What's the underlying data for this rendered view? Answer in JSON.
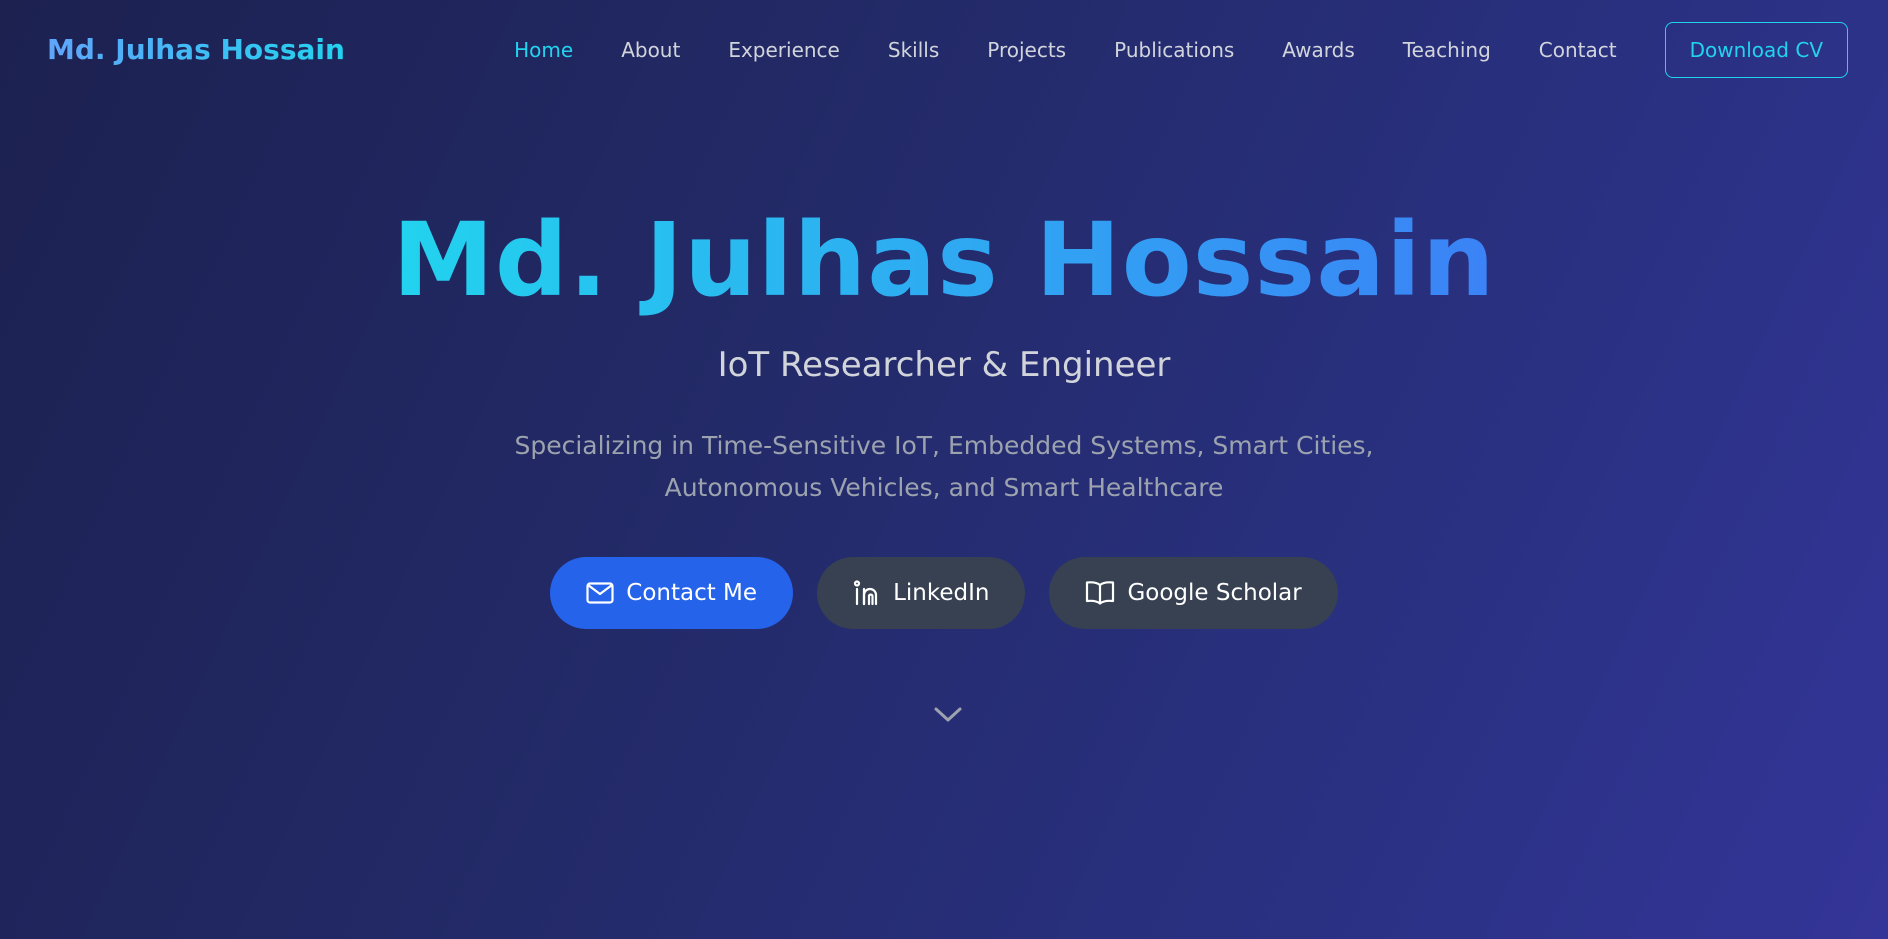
{
  "nav": {
    "brand": "Md. Julhas Hossain",
    "links": [
      {
        "label": "Home",
        "active": true
      },
      {
        "label": "About"
      },
      {
        "label": "Experience"
      },
      {
        "label": "Skills"
      },
      {
        "label": "Projects"
      },
      {
        "label": "Publications"
      },
      {
        "label": "Awards"
      },
      {
        "label": "Teaching"
      },
      {
        "label": "Contact"
      }
    ],
    "cv_label": "Download CV"
  },
  "hero": {
    "title": "Md. Julhas Hossain",
    "subtitle": "IoT Researcher & Engineer",
    "description": "Specializing in Time-Sensitive IoT, Embedded Systems, Smart Cities, Autonomous Vehicles, and Smart Healthcare",
    "buttons": [
      {
        "label": "Contact Me",
        "icon": "mail-icon"
      },
      {
        "label": "LinkedIn",
        "icon": "linkedin-icon"
      },
      {
        "label": "Google Scholar",
        "icon": "book-icon"
      }
    ],
    "scroll_icon": "chevron-down-icon"
  },
  "colors": {
    "accent": "#22d3ee",
    "primary_button": "#2563eb",
    "secondary_button": "#374151"
  }
}
